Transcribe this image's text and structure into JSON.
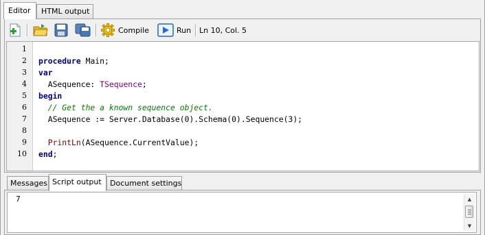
{
  "tabs": [
    "Editor",
    "HTML output"
  ],
  "toolbar": {
    "compile_label": "Compile",
    "run_label": "Run",
    "cursor_position": "Ln 10, Col. 5"
  },
  "editor": {
    "line_numbers": [
      "1",
      "2",
      "3",
      "4",
      "5",
      "6",
      "7",
      "8",
      "9",
      "10"
    ],
    "lines": [
      [],
      [
        {
          "t": "kw",
          "s": "procedure"
        },
        {
          "t": "tx",
          "s": " Main;"
        }
      ],
      [
        {
          "t": "kw",
          "s": "var"
        }
      ],
      [
        {
          "t": "tx",
          "s": "  ASequence: "
        },
        {
          "t": "ty",
          "s": "TSequence"
        },
        {
          "t": "tx",
          "s": ";"
        }
      ],
      [
        {
          "t": "kw",
          "s": "begin"
        }
      ],
      [
        {
          "t": "cm",
          "s": "  // Get the a known sequence object."
        }
      ],
      [
        {
          "t": "tx",
          "s": "  ASequence := Server.Database(0).Schema(0).Sequence(3);"
        }
      ],
      [],
      [
        {
          "t": "fn",
          "s": "  PrintLn"
        },
        {
          "t": "tx",
          "s": "(ASequence.CurrentValue);"
        }
      ],
      [
        {
          "t": "kw",
          "s": "end"
        },
        {
          "t": "tx",
          "s": ";"
        }
      ]
    ]
  },
  "bottom_tabs": [
    "Messages",
    "Script output",
    "Document settings"
  ],
  "output": {
    "text": "7"
  }
}
